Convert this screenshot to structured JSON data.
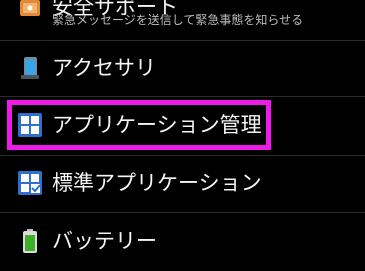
{
  "settings_list": {
    "items": [
      {
        "id": "safety-support",
        "title": "安全サポート",
        "subtitle": "緊急メッセージを送信して緊急事態を知らせる",
        "icon": "alarm-icon"
      },
      {
        "id": "accessories",
        "title": "アクセサリ",
        "icon": "phone-icon"
      },
      {
        "id": "application-manager",
        "title": "アプリケーション管理",
        "icon": "grid-icon",
        "highlighted": true
      },
      {
        "id": "default-applications",
        "title": "標準アプリケーション",
        "icon": "grid-check-icon"
      },
      {
        "id": "battery",
        "title": "バッテリー",
        "icon": "battery-icon"
      }
    ]
  },
  "colors": {
    "background": "#000000",
    "divider": "#2a2a2a",
    "highlight": "#ee1be8",
    "icon_blue": "#3a7bd5",
    "battery_green": "#3fae2a"
  }
}
